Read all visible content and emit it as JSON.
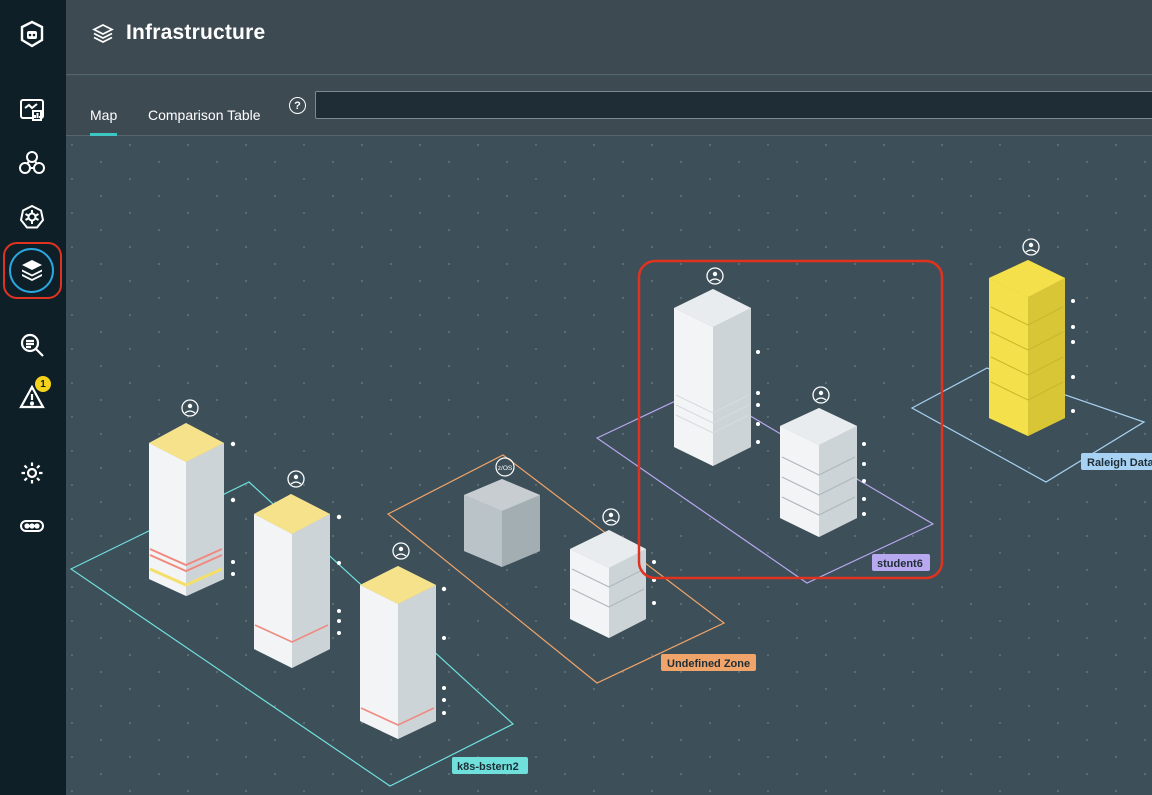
{
  "header": {
    "title": "Infrastructure",
    "title_icon": "layers-icon"
  },
  "tabs": [
    {
      "label": "Map",
      "active": true
    },
    {
      "label": "Comparison Table",
      "active": false
    }
  ],
  "search": {
    "value": "",
    "placeholder": ""
  },
  "sidebar": {
    "items": [
      {
        "icon": "logo-icon"
      },
      {
        "icon": "dashboard-icon"
      },
      {
        "icon": "applications-icon"
      },
      {
        "icon": "kubernetes-icon"
      },
      {
        "icon": "infrastructure-icon",
        "active": true
      },
      {
        "icon": "analyze-icon"
      },
      {
        "icon": "events-icon",
        "badge": "1"
      },
      {
        "icon": "settings-icon"
      },
      {
        "icon": "more-icon"
      }
    ]
  },
  "map": {
    "zones": [
      {
        "label": "k8s-bstern2",
        "color": "#6fe0dc"
      },
      {
        "label": "Undefined Zone",
        "color": "#f0a46a"
      },
      {
        "label": "student6",
        "color": "#b8a8ef"
      },
      {
        "label": "Raleigh Data",
        "color": "#a8d2f3"
      }
    ],
    "hosts": [
      {
        "name": "host",
        "os_icon": "linux-icon",
        "top_color": "#f5e28a"
      },
      {
        "name": "host",
        "os_icon": "linux-icon",
        "top_color": "#f5e28a"
      },
      {
        "name": "host",
        "os_icon": "linux-icon",
        "top_color": "#f5e28a"
      },
      {
        "name": "host",
        "os_icon": "zos-icon",
        "top_color": "#c7cdd1"
      },
      {
        "name": "host",
        "os_icon": "linux-icon",
        "top_color": "#e8ecee"
      },
      {
        "name": "host",
        "os_icon": "linux-icon",
        "top_color": "#e8ecee"
      },
      {
        "name": "host",
        "os_icon": "linux-icon",
        "top_color": "#e8ecee"
      },
      {
        "name": "host",
        "os_icon": "linux-icon",
        "top_color": "#f3e04a"
      }
    ],
    "zos_label": "z/OS",
    "highlight_color": "#e0331f"
  }
}
